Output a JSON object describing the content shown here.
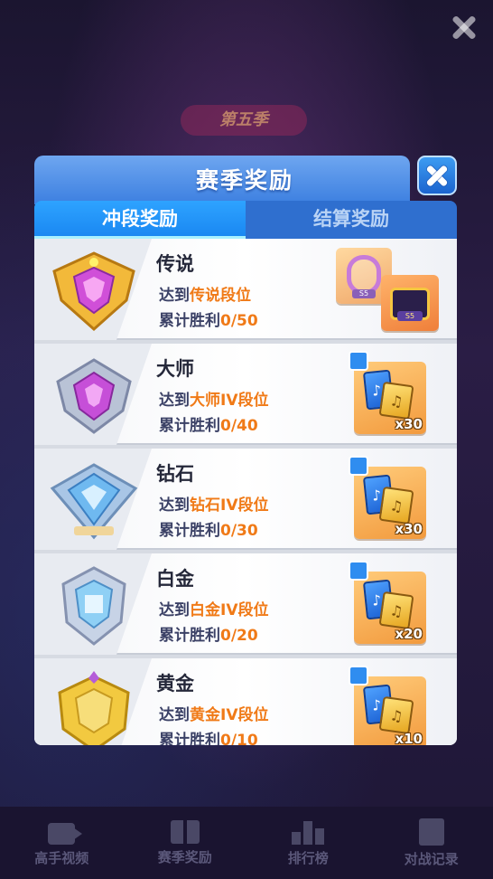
{
  "background": {
    "season_banner": "第五季"
  },
  "dialog": {
    "title": "赛季奖励",
    "tabs": [
      {
        "label": "冲段奖励",
        "active": true
      },
      {
        "label": "结算奖励",
        "active": false
      }
    ],
    "goal_prefix": "达到",
    "win_prefix": "累计胜利",
    "rows": [
      {
        "rank": "传说",
        "goal": "传说段位",
        "wins": "0/50",
        "reward_count": "",
        "badge_color": "#f2b93a"
      },
      {
        "rank": "大师",
        "goal": "大师IV段位",
        "wins": "0/40",
        "reward_count": "x30",
        "badge_color": "#c64fd8"
      },
      {
        "rank": "钻石",
        "goal": "钻石IV段位",
        "wins": "0/30",
        "reward_count": "x30",
        "badge_color": "#6fb9f0"
      },
      {
        "rank": "白金",
        "goal": "白金IV段位",
        "wins": "0/20",
        "reward_count": "x20",
        "badge_color": "#8fd0f5"
      },
      {
        "rank": "黄金",
        "goal": "黄金IV段位",
        "wins": "0/10",
        "reward_count": "x10",
        "badge_color": "#f2c940"
      }
    ],
    "legend_rewards": {
      "frame_tag": "S5",
      "chest_tag": "S5"
    }
  },
  "bottom_nav": [
    {
      "label": "高手视频",
      "icon": "video-icon"
    },
    {
      "label": "赛季奖励",
      "icon": "gift-icon"
    },
    {
      "label": "排行榜",
      "icon": "leaderboard-icon"
    },
    {
      "label": "对战记录",
      "icon": "record-icon"
    }
  ],
  "colors": {
    "highlight": "#f07a17",
    "tab_active": "#1a88f2",
    "header": "#3c7fe0"
  }
}
